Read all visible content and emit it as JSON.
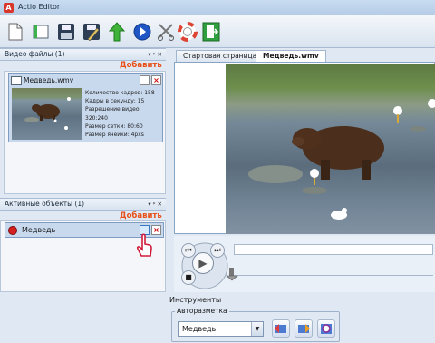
{
  "window": {
    "title": "Actio Editor",
    "app_icon_letter": "A"
  },
  "toolbar": {
    "icons": [
      "new-file-icon",
      "open-icon",
      "save-icon",
      "save-as-icon",
      "upload-icon",
      "play-icon",
      "cut-icon",
      "help-icon",
      "exit-icon"
    ]
  },
  "video_panel": {
    "header": "Видео файлы (1)",
    "header_tools": "▾ ᵖ ✕",
    "add_label": "Добавить",
    "file": {
      "name": "Медведь.wmv",
      "props": [
        "Количество кадров: 158",
        "Кадры в секунду: 15",
        "Разрешение видео: 320:240",
        "Размер сетки: 80:60",
        "Размер ячейки: 4pxs"
      ]
    }
  },
  "objects_panel": {
    "header": "Активные объекты (1)",
    "header_tools": "▾ ᵖ ✕",
    "add_label": "Добавить",
    "object_name": "Медведь",
    "object_color": "#d42020"
  },
  "tabs": [
    {
      "label": "Стартовая страница",
      "active": false
    },
    {
      "label": "Медведь.wmv",
      "active": true
    }
  ],
  "tools": {
    "header": "Инструменты",
    "group_label": "Авторазметка",
    "select_value": "Медведь"
  },
  "colors": {
    "accent": "#e8501a",
    "panel": "#c8d9ee",
    "border": "#7f9dc2"
  }
}
